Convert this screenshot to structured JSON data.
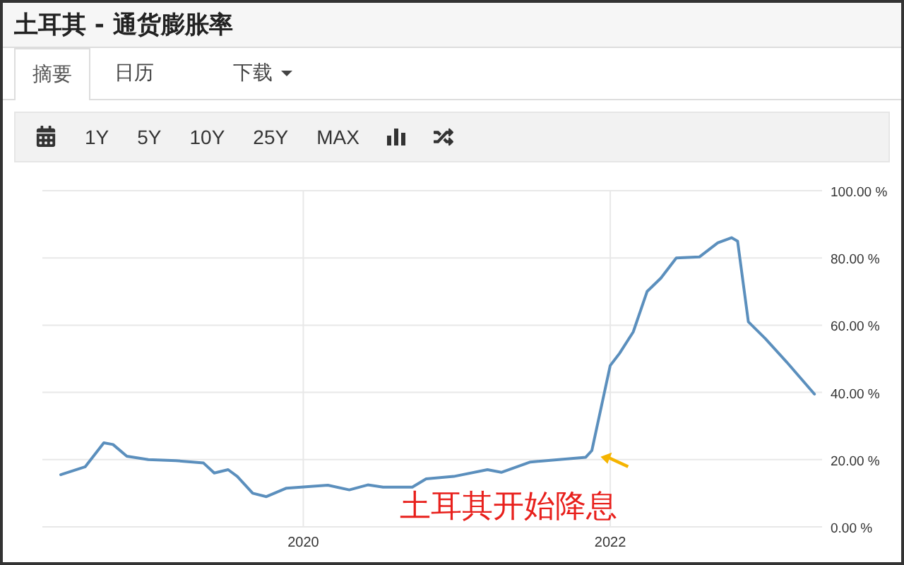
{
  "page": {
    "title": "土耳其 - 通货膨胀率"
  },
  "tabs": [
    {
      "label": "摘要",
      "selected": true,
      "kind": "tab"
    },
    {
      "label": "日历",
      "selected": false,
      "kind": "tab"
    },
    {
      "label": "下载",
      "selected": false,
      "kind": "dropdown"
    }
  ],
  "toolbar": {
    "ranges": [
      "1Y",
      "5Y",
      "10Y",
      "25Y",
      "MAX"
    ]
  },
  "chart": {
    "chart_data": {
      "type": "line",
      "x": [
        2018.42,
        2018.58,
        2018.7,
        2018.76,
        2018.85,
        2018.99,
        2019.17,
        2019.35,
        2019.42,
        2019.51,
        2019.57,
        2019.67,
        2019.76,
        2019.89,
        2020.16,
        2020.3,
        2020.42,
        2020.52,
        2020.71,
        2020.8,
        2020.98,
        2021.2,
        2021.29,
        2021.48,
        2021.84,
        2021.88,
        2022.0,
        2022.06,
        2022.15,
        2022.24,
        2022.33,
        2022.43,
        2022.58,
        2022.7,
        2022.79,
        2022.83,
        2022.9,
        2023.01,
        2023.15,
        2023.33
      ],
      "series": [
        {
          "color": "#5b8fbd",
          "values": [
            15.5,
            17.9,
            25,
            24.5,
            21,
            20,
            19.7,
            19,
            16,
            17,
            15,
            10,
            9,
            11.5,
            12.4,
            11,
            12.5,
            11.8,
            11.8,
            14.3,
            15,
            17,
            16.2,
            19.3,
            20.7,
            22.7,
            48,
            51.6,
            58,
            70,
            74,
            80,
            80.3,
            84.5,
            86,
            85,
            61,
            56,
            49,
            39.5
          ]
        }
      ],
      "xlim": [
        2018.3,
        2023.38
      ],
      "ylim": [
        0,
        100
      ],
      "grid": true,
      "xticks": [
        {
          "value": 2020,
          "label": "2020"
        },
        {
          "value": 2022,
          "label": "2022"
        }
      ],
      "yticks": [
        {
          "value": 0,
          "label": "0.00 %"
        },
        {
          "value": 20,
          "label": "20.00 %"
        },
        {
          "value": 40,
          "label": "40.00 %"
        },
        {
          "value": 60,
          "label": "60.00 %"
        },
        {
          "value": 80,
          "label": "80.00 %"
        },
        {
          "value": 100,
          "label": "100.00 %"
        }
      ],
      "annotations": [
        {
          "text": "土耳其开始降息",
          "x": 2021.9,
          "y": 20
        }
      ]
    }
  }
}
